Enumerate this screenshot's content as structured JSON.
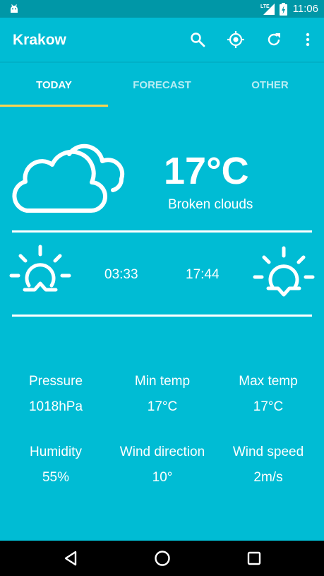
{
  "status_bar": {
    "network_label": "LTE",
    "time": "11:06"
  },
  "app_bar": {
    "title": "Krakow",
    "actions": [
      "search-icon",
      "location-icon",
      "refresh-icon",
      "more-vert-icon"
    ]
  },
  "tabs": [
    {
      "label": "TODAY",
      "active": true
    },
    {
      "label": "FORECAST",
      "active": false
    },
    {
      "label": "OTHER",
      "active": false
    }
  ],
  "current": {
    "icon": "broken-clouds-icon",
    "temperature": "17°C",
    "description": "Broken clouds"
  },
  "sun": {
    "sunrise_icon": "sunrise-icon",
    "sunrise": "03:33",
    "sunset": "17:44",
    "sunset_icon": "sunset-icon"
  },
  "details": [
    {
      "label": "Pressure",
      "value": "1018hPa"
    },
    {
      "label": "Min temp",
      "value": "17°C"
    },
    {
      "label": "Max temp",
      "value": "17°C"
    },
    {
      "label": "Humidity",
      "value": "55%"
    },
    {
      "label": "Wind direction",
      "value": "10°"
    },
    {
      "label": "Wind speed",
      "value": "2m/s"
    }
  ],
  "colors": {
    "primary": "#00BCD4",
    "primary_dark": "#0097A7",
    "tab_indicator": "#FFD54F",
    "text": "#FFFFFF"
  },
  "nav_bar": [
    "back-icon",
    "home-icon",
    "recents-icon"
  ]
}
